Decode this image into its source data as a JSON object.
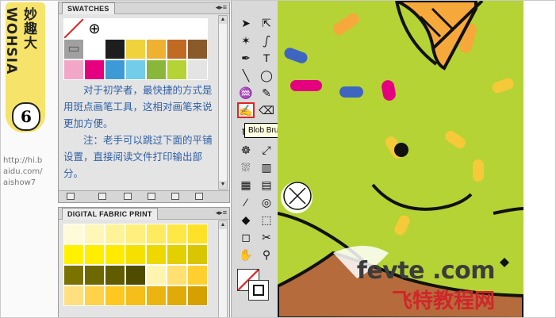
{
  "branding": {
    "logo_text": "妙趣大WOHSIA",
    "logo_number": "6",
    "url_lines": [
      "http://hi.b",
      "aidu.com/",
      "aishow7"
    ]
  },
  "swatches_panel": {
    "title": "SWATCHES",
    "rows": [
      [
        "#ffffff",
        "#ffffff",
        "#ffffff",
        "#ffffff",
        "#ffffff",
        "#ffffff",
        "#ffffff"
      ],
      [
        "#a0a0a0",
        "#ffffff",
        "#1e1e1e",
        "#f0d23c",
        "#f0b030",
        "#c06a24",
        "#8a5a2a"
      ],
      [
        "#f2a6c8",
        "#e4007e",
        "#3e9ad6",
        "#72cde8",
        "#8ab63c",
        "#b5d334",
        "#e4e4e4"
      ]
    ]
  },
  "note": {
    "paragraph1": "对于初学者，最快捷的方式是用斑点画笔工具，这相对画笔来说更加方便。",
    "paragraph2": "注：老手可以跳过下面的平铺设置，直接阅读文件打印输出部分。"
  },
  "fabric_panel": {
    "title": "DIGITAL FABRIC PRINT",
    "rows": [
      [
        "#fffbd8",
        "#fff7b8",
        "#fff39a",
        "#ffef7c",
        "#ffeb60",
        "#ffe744",
        "#ffe12a"
      ],
      [
        "#fff100",
        "#ffee00",
        "#ffea00",
        "#f6e000",
        "#eed800",
        "#e4cf00",
        "#dac600"
      ],
      [
        "#7b7300",
        "#6e6800",
        "#615c00",
        "#4f4c00",
        "#fff5b0",
        "#ffe070",
        "#ffd030"
      ],
      [
        "#ffe080",
        "#ffd24a",
        "#ffc820",
        "#f5be1a",
        "#ebb410",
        "#e0aa08",
        "#d6a000"
      ]
    ]
  },
  "tools": {
    "icons": [
      "selection-icon",
      "direct-selection-icon",
      "magic-wand-icon",
      "lasso-icon",
      "pen-icon",
      "type-icon",
      "line-icon",
      "ellipse-icon",
      "paintbrush-icon",
      "pencil-icon",
      "blob-brush-icon",
      "eraser-icon",
      "rotate-icon",
      "scale-icon",
      "warp-icon",
      "free-transform-icon",
      "symbol-sprayer-icon",
      "column-graph-icon",
      "mesh-icon",
      "gradient-icon",
      "eyedropper-icon",
      "blend-icon",
      "live-paint-icon",
      "live-paint-select-icon",
      "artboard-icon",
      "slice-icon",
      "hand-icon",
      "zoom-icon"
    ],
    "tooltip": "Blob Brush Tool (Shift+B)"
  },
  "watermark": {
    "line1": "fevte .com",
    "line2": "飞特教程网"
  },
  "colors": {
    "canvas_bg": "#b5d334",
    "highlight": "#e02424"
  }
}
